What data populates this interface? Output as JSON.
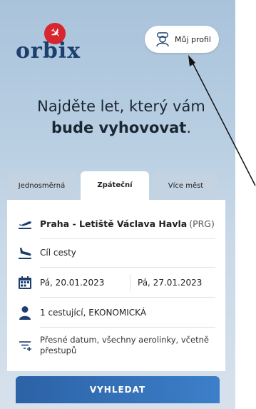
{
  "logo": {
    "text": "orbix"
  },
  "profile": {
    "label": "Můj profil"
  },
  "headline": {
    "line1": "Najděte let, který vám",
    "line2_bold": "bude vyhovovat",
    "line2_end": "."
  },
  "tabs": [
    {
      "label": "Jednosměrná",
      "active": false
    },
    {
      "label": "Zpáteční",
      "active": true
    },
    {
      "label": "Více měst",
      "active": false
    }
  ],
  "form": {
    "origin": {
      "bold": "Praha - Letiště Václava Havla",
      "code": "(PRG)"
    },
    "destination": {
      "placeholder": "Cíl cesty"
    },
    "dates": {
      "depart": "Pá, 20.01.2023",
      "return": "Pá, 27.01.2023"
    },
    "passengers": "1 cestující, EKONOMICKÁ",
    "options": "Přesné datum, všechny aerolinky, včetně přestupů"
  },
  "search": {
    "label": "VYHLEDAT"
  },
  "colors": {
    "accent": "#2c62a6",
    "brand_red": "#d7262f",
    "brand_navy": "#1c3f6e"
  }
}
